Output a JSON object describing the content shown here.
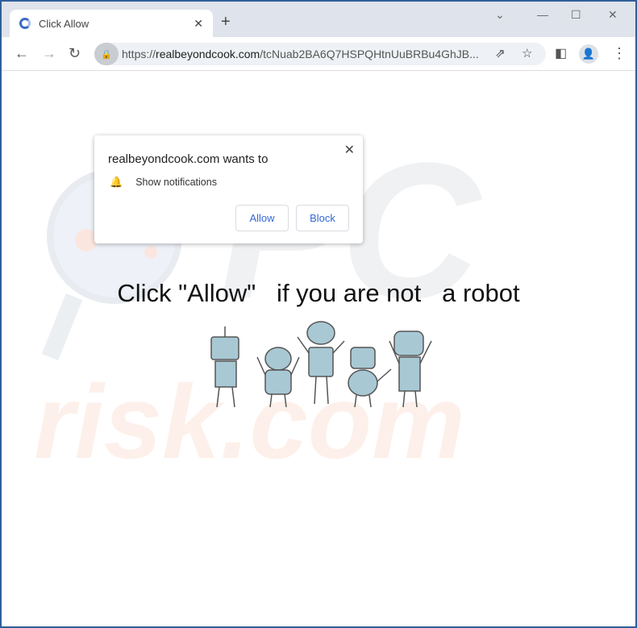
{
  "tab": {
    "title": "Click Allow",
    "favicon": "loading-favicon-icon"
  },
  "address": {
    "scheme": "https://",
    "domain": "realbeyondcook.com",
    "path": "/tcNuab2BA6Q7HSPQHtnUuBRBu4GhJB..."
  },
  "popup": {
    "heading": "realbeyondcook.com wants to",
    "permission": "Show notifications",
    "allow": "Allow",
    "block": "Block"
  },
  "page": {
    "message": "Click \"Allow\"   if you are not   a robot"
  },
  "watermark": {
    "top": "PC",
    "bottom": "risk.com"
  },
  "colors": {
    "accent": "#3367d6",
    "frame": "#2f5f9a",
    "robot": "#a8c8d4"
  }
}
